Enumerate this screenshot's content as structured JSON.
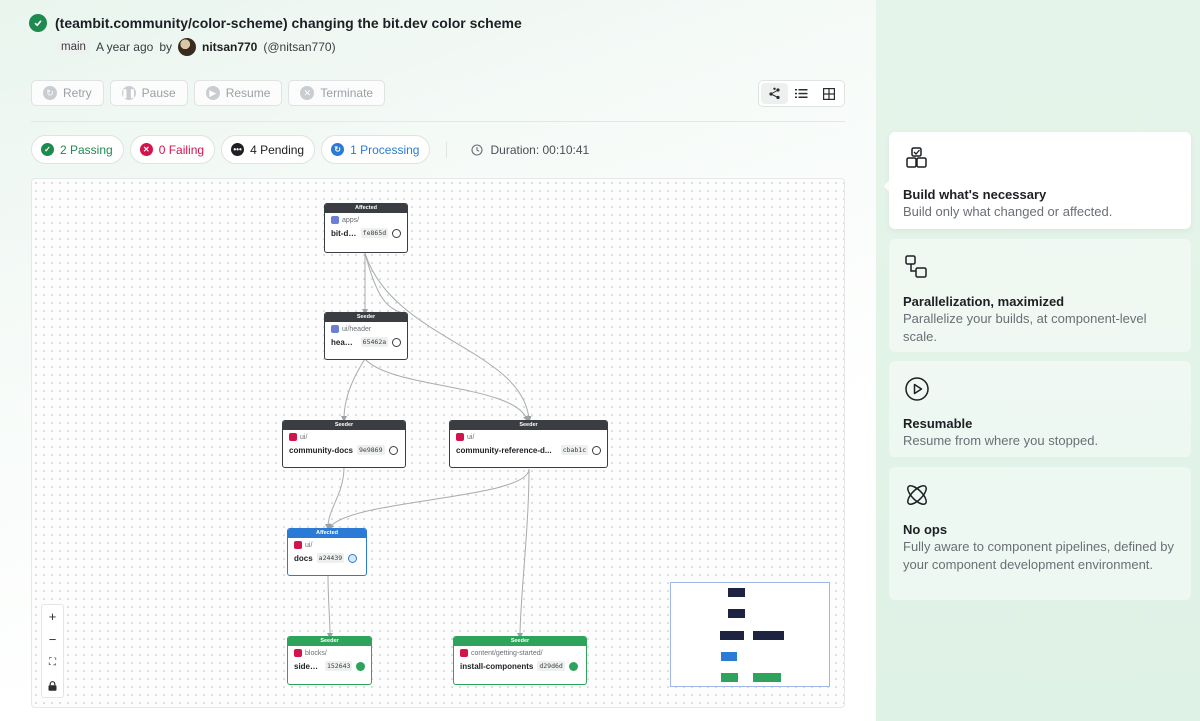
{
  "header": {
    "title": "(teambit.community/color-scheme) changing the bit.dev color scheme",
    "branch": "main",
    "time": "A year ago",
    "by": "by",
    "user": "nitsan770",
    "handle": "(@nitsan770)"
  },
  "actions": [
    {
      "label": "Retry",
      "icon": "retry-icon"
    },
    {
      "label": "Pause",
      "icon": "pause-icon"
    },
    {
      "label": "Resume",
      "icon": "play-icon"
    },
    {
      "label": "Terminate",
      "icon": "terminate-icon"
    }
  ],
  "view_modes": [
    "graph-view-icon",
    "list-view-icon",
    "grid-view-icon"
  ],
  "statuses": [
    {
      "label": "2 Passing",
      "color": "#1e8a4e"
    },
    {
      "label": "0 Failing",
      "color": "#d3134b"
    },
    {
      "label": "4 Pending",
      "color": "#1d1f23"
    },
    {
      "label": "1 Processing",
      "color": "#2b7ad6"
    }
  ],
  "duration": "Duration: 00:10:41",
  "graph": {
    "nodes": [
      {
        "head": "Affected",
        "path": "apps/",
        "name": "bit-dev",
        "hash": "fe865d",
        "state": "pending"
      },
      {
        "head": "Seeder",
        "path": "ui/header",
        "name": "header",
        "hash": "65462a",
        "state": "pending"
      },
      {
        "head": "Seeder",
        "path": "ui/",
        "name": "community-docs",
        "hash": "9e9869",
        "state": "pending"
      },
      {
        "head": "Seeder",
        "path": "ui/",
        "name": "community-reference-d...",
        "hash": "cbab1c",
        "state": "pending"
      },
      {
        "head": "Affected",
        "path": "ui/",
        "name": "docs",
        "hash": "a24439",
        "state": "processing"
      },
      {
        "head": "Seeder",
        "path": "blocks/",
        "name": "sidebar",
        "hash": "152643",
        "state": "done"
      },
      {
        "head": "Seeder",
        "path": "content/getting-started/",
        "name": "install-components",
        "hash": "d29d6d",
        "state": "done"
      }
    ],
    "zoom_controls": [
      "zoom-in",
      "zoom-out",
      "fit-view",
      "lock"
    ]
  },
  "features": [
    {
      "title": "Build what's necessary",
      "text": "Build only what changed or affected.",
      "icon": "blocks-icon"
    },
    {
      "title": "Parallelization, maximized",
      "text": "Parallelize your builds, at component-level scale.",
      "icon": "parallel-icon"
    },
    {
      "title": "Resumable",
      "text": "Resume from where you stopped.",
      "icon": "resume-icon"
    },
    {
      "title": "No ops",
      "text": "Fully aware to component pipelines, defined by your component development environment.",
      "icon": "orbit-icon"
    }
  ],
  "colors": {
    "brand_green": "#1e8a4e",
    "accent_blue": "#2b7ad6",
    "dark_head": "#3a3d42",
    "scope_pink": "#d3134b"
  }
}
